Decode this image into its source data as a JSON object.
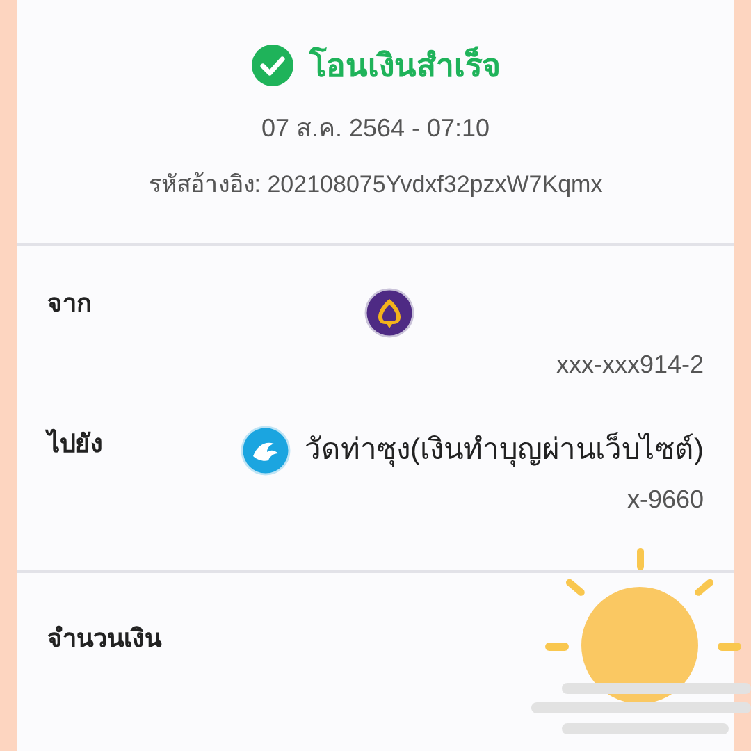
{
  "status": {
    "title": "โอนเงินสำเร็จ",
    "datetime": "07 ส.ค. 2564 - 07:10",
    "reference": "รหัสอ้างอิง: 202108075Yvdxf32pzxW7Kqmx"
  },
  "from": {
    "label": "จาก",
    "account": "xxx-xxx914-2"
  },
  "to": {
    "label": "ไปยัง",
    "name": "วัดท่าซุง(เงินทำบุญผ่านเว็บไซต์)",
    "account": "x-9660"
  },
  "amount": {
    "label": "จำนวนเงิน"
  }
}
